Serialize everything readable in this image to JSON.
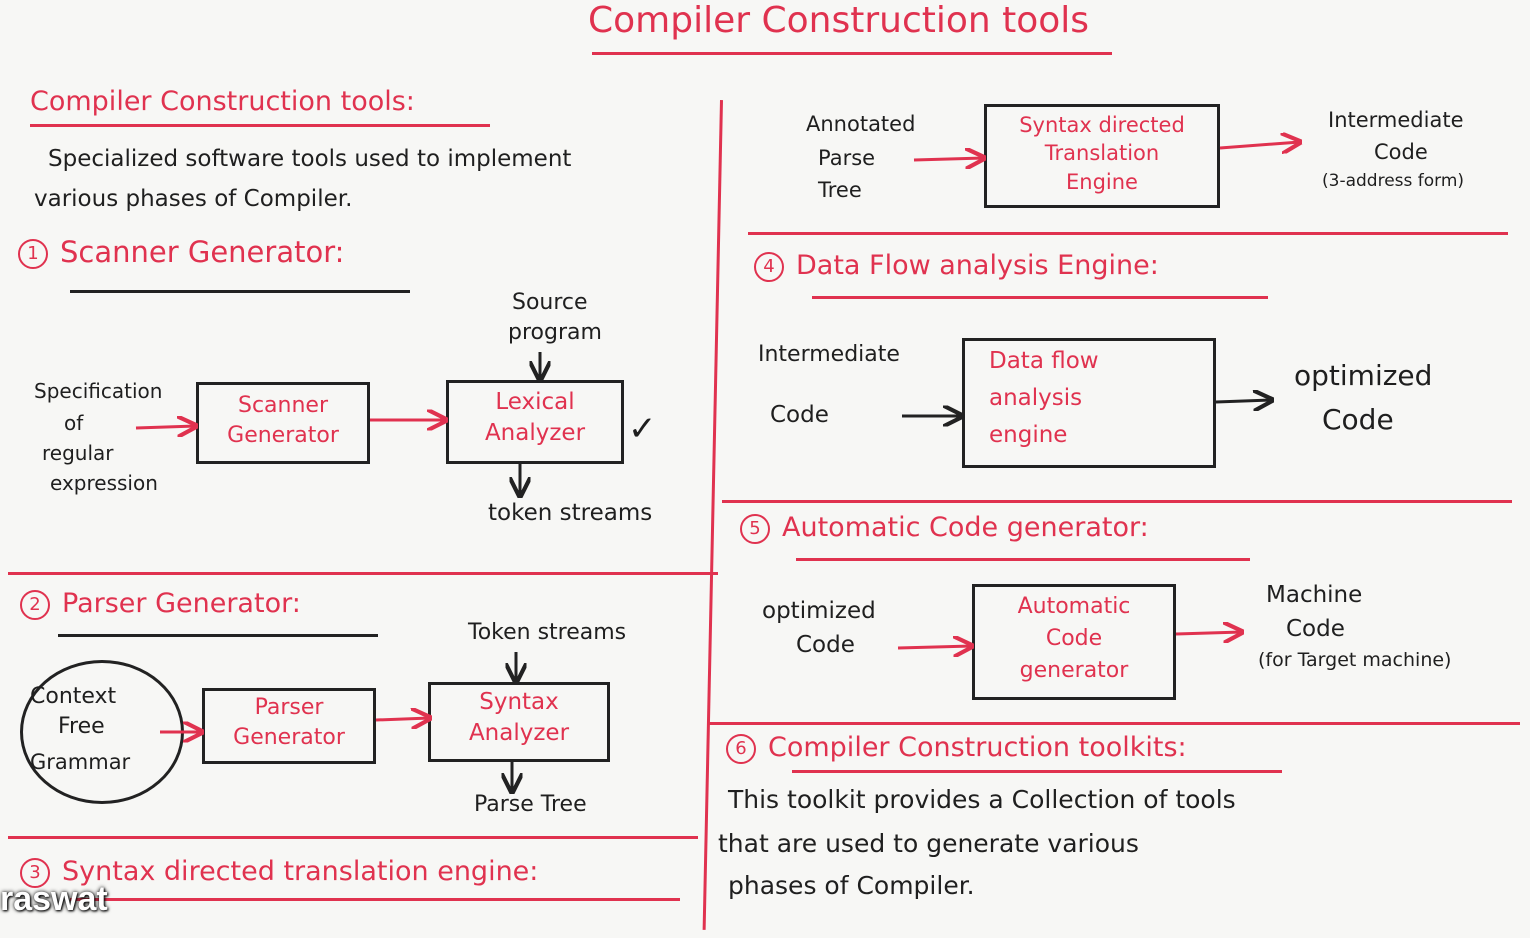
{
  "title": "Compiler Construction tools",
  "intro": {
    "heading": "Compiler Construction tools:",
    "line1": "Specialized software tools used to implement",
    "line2": "various phases of Compiler."
  },
  "s1": {
    "num": "1",
    "heading": "Scanner Generator:",
    "input": [
      "Specification",
      "of",
      "regular",
      "expression"
    ],
    "box1": "Scanner\nGenerator",
    "box2": "Lexical\nAnalyzer",
    "top": [
      "Source",
      "program"
    ],
    "bottom": "token streams",
    "tick": "✓"
  },
  "s2": {
    "num": "2",
    "heading": "Parser Generator:",
    "input": [
      "Context",
      "Free",
      "Grammar"
    ],
    "box1": "Parser\nGenerator",
    "box2": "Syntax\nAnalyzer",
    "top": "Token streams",
    "bottom": "Parse Tree"
  },
  "s3": {
    "num": "3",
    "heading": "Syntax directed translation engine:",
    "input": [
      "Annotated",
      "Parse",
      "Tree"
    ],
    "box": "Syntax directed\nTranslation\nEngine",
    "output": [
      "Intermediate",
      "Code",
      "(3-address form)"
    ]
  },
  "s4": {
    "num": "4",
    "heading": "Data Flow analysis Engine:",
    "input": [
      "Intermediate",
      "Code"
    ],
    "box": "Data flow\nanalysis\nengine",
    "output": [
      "optimized",
      "Code"
    ]
  },
  "s5": {
    "num": "5",
    "heading": "Automatic Code generator:",
    "input": [
      "optimized",
      "Code"
    ],
    "box": "Automatic\nCode\ngenerator",
    "output": [
      "Machine",
      "Code",
      "(for Target machine)"
    ]
  },
  "s6": {
    "num": "6",
    "heading": "Compiler Construction toolkits:",
    "line1": "This toolkit provides a Collection of tools",
    "line2": "that are used to generate various",
    "line3": "phases of Compiler."
  },
  "watermark": "raswat",
  "colors": {
    "ink": "#1f1f1f",
    "accent": "#e0324f",
    "board": "#f7f7f5"
  }
}
